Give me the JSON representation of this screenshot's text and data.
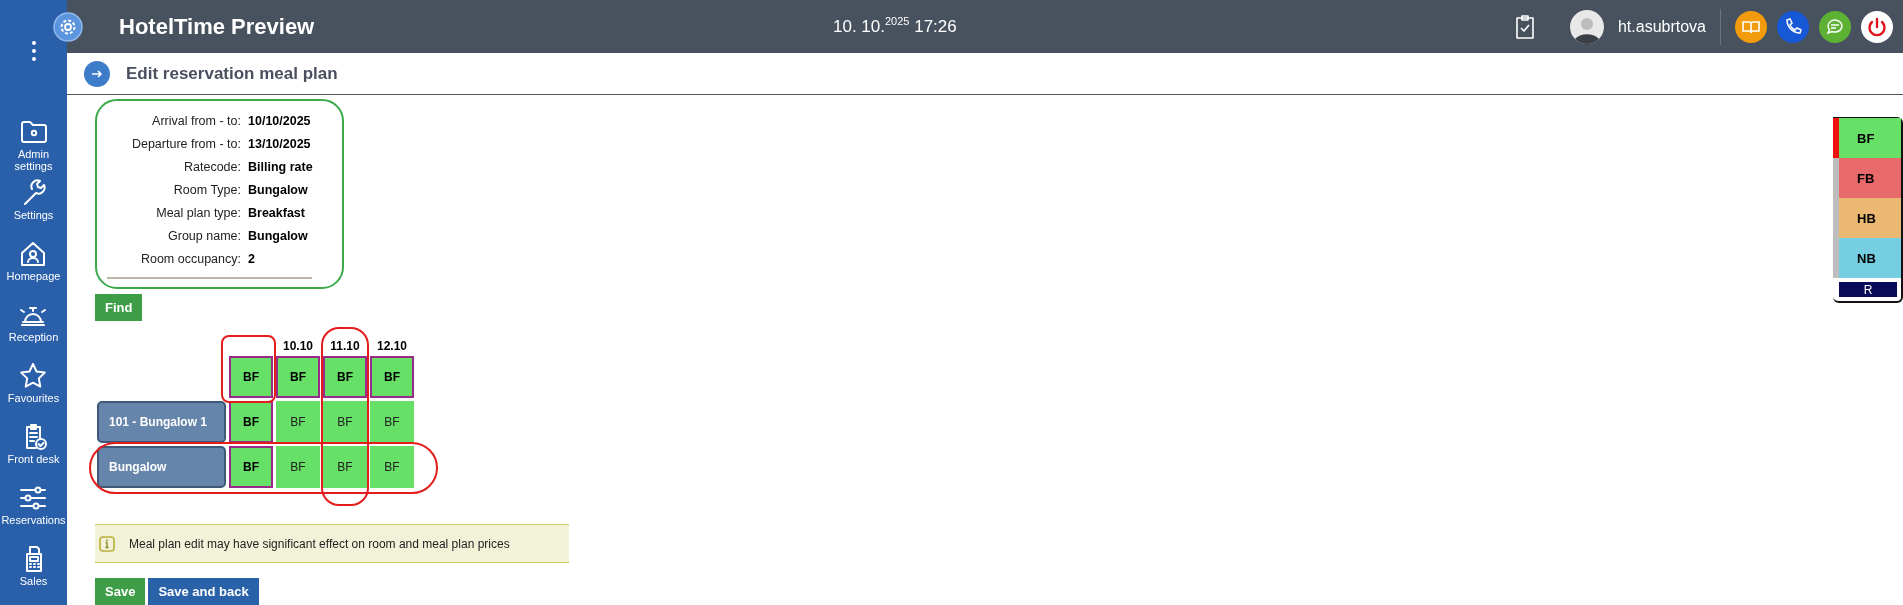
{
  "app": {
    "title": "HotelTime Preview",
    "datetime": "10. 10.$^{2025}$ 17:26",
    "user": "ht.asubrtova"
  },
  "sidebar": {
    "items": [
      {
        "label": "Admin settings"
      },
      {
        "label": "Settings"
      },
      {
        "label": "Homepage"
      },
      {
        "label": "Reception"
      },
      {
        "label": "Favourites"
      },
      {
        "label": "Front desk"
      },
      {
        "label": "Reservations"
      },
      {
        "label": "Sales"
      }
    ]
  },
  "page": {
    "title": "Edit reservation meal plan"
  },
  "info": [
    {
      "label": "Arrival from - to:",
      "value": "10/10/2025"
    },
    {
      "label": "Departure from - to:",
      "value": "13/10/2025"
    },
    {
      "label": "Ratecode:",
      "value": "Billing rate"
    },
    {
      "label": "Room Type:",
      "value": "Bungalow"
    },
    {
      "label": "Meal plan type:",
      "value": "Breakfast"
    },
    {
      "label": "Group name:",
      "value": "Bungalow"
    },
    {
      "label": "Room occupancy:",
      "value": "2"
    }
  ],
  "find_button": "Find",
  "grid": {
    "columns": [
      {
        "circled": false,
        "header": {
          "text": "BF",
          "selected": true,
          "circled": true
        }
      },
      {
        "date": "10.10",
        "circled": false,
        "header": {
          "text": "BF",
          "selected": true,
          "circled": false
        }
      },
      {
        "date": "11.10",
        "circled": true,
        "header": {
          "text": "BF",
          "selected": true,
          "circled": false
        }
      },
      {
        "date": "12.10",
        "circled": false,
        "header": {
          "text": "BF",
          "selected": true,
          "circled": false
        }
      }
    ],
    "rows": [
      {
        "label": "101 - Bungalow 1",
        "circled": false,
        "cells": [
          {
            "text": "BF",
            "selected": true
          },
          {
            "text": "BF",
            "selected": false
          },
          {
            "text": "BF",
            "selected": false
          },
          {
            "text": "BF",
            "selected": false
          }
        ]
      },
      {
        "label": "Bungalow",
        "circled": true,
        "cells": [
          {
            "text": "BF",
            "selected": true
          },
          {
            "text": "BF",
            "selected": false
          },
          {
            "text": "BF",
            "selected": false
          },
          {
            "text": "BF",
            "selected": false
          }
        ]
      }
    ]
  },
  "notice": "Meal plan edit may have significant effect on room and meal plan prices",
  "buttons": [
    {
      "label": "Save",
      "kind": "save"
    },
    {
      "label": "Save and back",
      "kind": "save-back"
    }
  ],
  "legend": {
    "items": [
      {
        "label": "BF",
        "color": "#66e066",
        "selected": true
      },
      {
        "label": "FB",
        "color": "#e86a6a",
        "selected": false
      },
      {
        "label": "HB",
        "color": "#ebb872",
        "selected": false
      },
      {
        "label": "NB",
        "color": "#76cfe0",
        "selected": false
      }
    ],
    "button": "R"
  }
}
